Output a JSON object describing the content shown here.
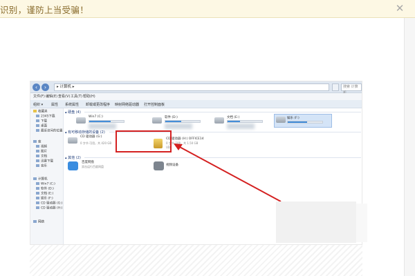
{
  "banner": {
    "text": "识别，谨防上当受骗！",
    "close_glyph": "✕"
  },
  "explorer": {
    "address": "▸ 计算机 ▸",
    "search_placeholder": "搜索 计算机",
    "menu": [
      "文件(F)",
      "编辑(E)",
      "查看(V)",
      "工具(T)",
      "帮助(H)"
    ],
    "toolbar": [
      "组织 ▾",
      "属性",
      "系统属性",
      "卸载或更改程序",
      "映射网络驱动器",
      "打开控制面板"
    ],
    "nav": {
      "favorites": [
        "收藏夹",
        "2345下载",
        "下载",
        "桌面",
        "最近访问的位置"
      ],
      "libraries": [
        "库",
        "视频",
        "图片",
        "文档",
        "迅雷下载",
        "音乐"
      ],
      "computer": [
        "计算机",
        "Win7 (C:)",
        "软件 (D:)",
        "文档 (E:)",
        "娱乐 (F:)",
        "CD 驱动器 (G:)",
        "CD 驱动器 (H:)"
      ],
      "network": [
        "网络"
      ]
    },
    "sections": {
      "hdd": "▴ 硬盘 (4)",
      "removable": "▴ 有可移动存储的设备 (2)",
      "other": "▴ 其他 (2)"
    },
    "drives": [
      {
        "name": "Win7 (C:)",
        "fill": 0.62,
        "free": ""
      },
      {
        "name": "软件 (D:)",
        "fill": 0.45,
        "free": ""
      },
      {
        "name": "文档 (E:)",
        "fill": 0.35,
        "free": ""
      },
      {
        "name": "娱乐 (F:)",
        "fill": 0.55,
        "free": ""
      }
    ],
    "removable_items": [
      {
        "name": "CD 驱动器 (G:)",
        "sub": "0 字节 可用，共 420 GB"
      },
      {
        "name": "CD 驱动器 (H:) OFFICE14",
        "sub": "0 字节 可用，共 1.50 GB",
        "fs": "UDF"
      }
    ],
    "other_items": [
      {
        "name": "百度网盘",
        "sub": "双击运行百度网盘"
      },
      {
        "name": "视频设备",
        "sub": ""
      }
    ]
  }
}
